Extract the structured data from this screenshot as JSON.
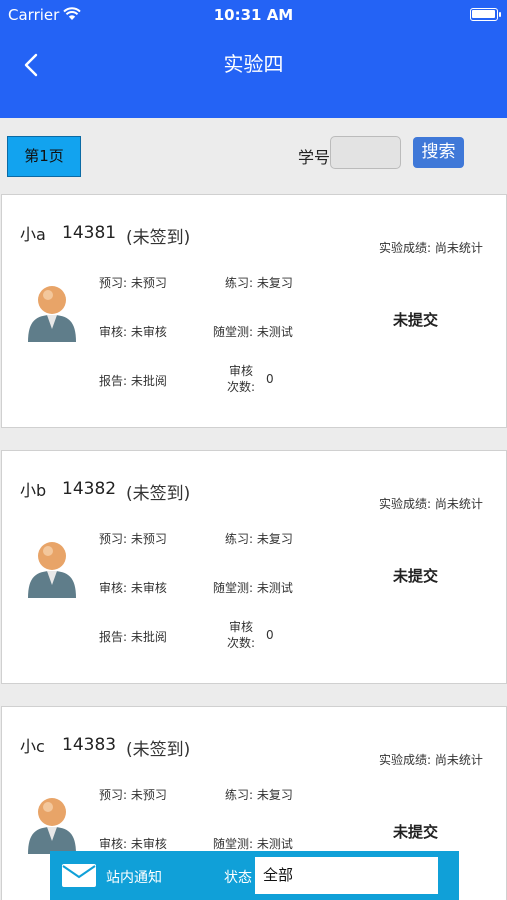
{
  "status_bar": {
    "carrier": "Carrier",
    "time": "10:31 AM"
  },
  "header": {
    "title": "实验四"
  },
  "toolbar": {
    "page_label": "第1页",
    "student_id_label": "学号",
    "student_id_value": "",
    "search_label": "搜索"
  },
  "labels": {
    "grade": "实验成绩: 尚未统计",
    "preview": "预习: 未预习",
    "practice": "练习: 未复习",
    "review": "审核: 未审核",
    "quiz": "随堂测: 未测试",
    "report": "报告: 未批阅",
    "review_count_label_1": "审核",
    "review_count_label_2": "次数:",
    "submission": "未提交"
  },
  "students": [
    {
      "name": "小a",
      "id": "14381",
      "checkin": "(未签到)",
      "review_count": "0"
    },
    {
      "name": "小b",
      "id": "14382",
      "checkin": "(未签到)",
      "review_count": "0"
    },
    {
      "name": "小c",
      "id": "14383",
      "checkin": "(未签到)",
      "review_count": ""
    }
  ],
  "bottom_bar": {
    "notice_label": "站内通知",
    "state_label": "状态",
    "state_value": "全部"
  },
  "colors": {
    "nav": "#2463f5",
    "page_button": "#12a3ef",
    "search_button": "#3f78d8",
    "bottom_bar": "#10a0d8"
  }
}
